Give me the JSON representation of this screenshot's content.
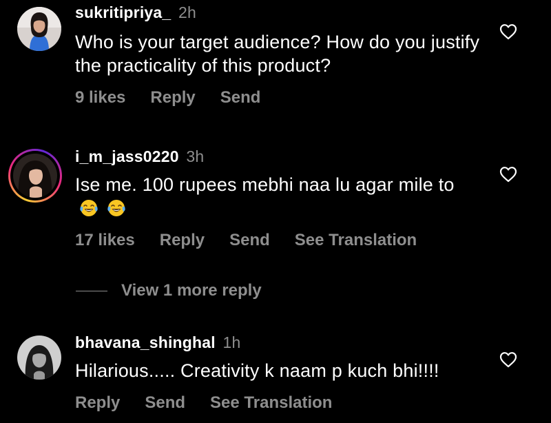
{
  "comments": [
    {
      "username": "sukritipriya_",
      "time": "2h",
      "text": "Who is your target audience? How do you justify the practicality of this product?",
      "actions": [
        "9 likes",
        "Reply",
        "Send"
      ]
    },
    {
      "username": "i_m_jass0220",
      "time": "3h",
      "text": "Ise me. 100 rupees mebhi naa lu agar mile to",
      "emoji": "face-with-tears-of-joy",
      "actions": [
        "17 likes",
        "Reply",
        "Send",
        "See Translation"
      ]
    },
    {
      "username": "bhavana_shinghal",
      "time": "1h",
      "text": "Hilarious..... Creativity k naam p kuch bhi!!!!",
      "actions": [
        "Reply",
        "Send",
        "See Translation"
      ]
    }
  ],
  "view_more": {
    "label": "View 1 more reply"
  },
  "colors": {
    "background": "#000000",
    "text_primary": "#ffffff",
    "text_secondary": "#8e8e8e"
  },
  "icons": {
    "like": "heart-outline-icon"
  }
}
